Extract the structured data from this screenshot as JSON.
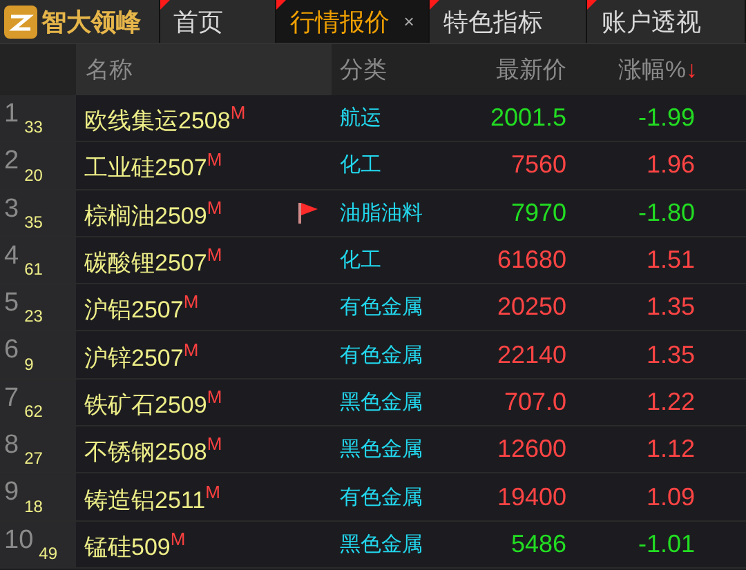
{
  "logo": {
    "text": "智大领峰"
  },
  "tabs": [
    {
      "label": "首页",
      "selected": false
    },
    {
      "label": "行情报价",
      "selected": true,
      "close": "×"
    },
    {
      "label": "特色指标",
      "selected": false
    },
    {
      "label": "账户透视",
      "selected": false
    }
  ],
  "table": {
    "columns": [
      {
        "label": "名称"
      },
      {
        "label": "分类"
      },
      {
        "label": "最新价"
      },
      {
        "label": "涨幅%",
        "sort_indicator": "↓"
      }
    ],
    "rows": [
      {
        "index": "1",
        "rank": "33",
        "name": "欧线集运2508$^{M}$",
        "flagged": false,
        "category": "航运",
        "price": "2001.5",
        "change": "-1.99",
        "color": "#22dd22"
      },
      {
        "index": "2",
        "rank": "20",
        "name": "工业硅2507$^{M}$",
        "flagged": false,
        "category": "化工",
        "price": "7560",
        "change": "1.96",
        "color": "#ff4444"
      },
      {
        "index": "3",
        "rank": "35",
        "name": "棕榈油2509$^{M}$",
        "flagged": true,
        "category": "油脂油料",
        "price": "7970",
        "change": "-1.80",
        "color": "#22dd22"
      },
      {
        "index": "4",
        "rank": "61",
        "name": "碳酸锂2507$^{M}$",
        "flagged": false,
        "category": "化工",
        "price": "61680",
        "change": "1.51",
        "color": "#ff4444"
      },
      {
        "index": "5",
        "rank": "23",
        "name": "沪铝2507$^{M}$",
        "flagged": false,
        "category": "有色金属",
        "price": "20250",
        "change": "1.35",
        "color": "#ff4444"
      },
      {
        "index": "6",
        "rank": "9",
        "name": "沪锌2507$^{M}$",
        "flagged": false,
        "category": "有色金属",
        "price": "22140",
        "change": "1.35",
        "color": "#ff4444"
      },
      {
        "index": "7",
        "rank": "62",
        "name": "铁矿石2509$^{M}$",
        "flagged": false,
        "category": "黑色金属",
        "price": "707.0",
        "change": "1.22",
        "color": "#ff4444"
      },
      {
        "index": "8",
        "rank": "27",
        "name": "不锈钢2508$^{M}$",
        "flagged": false,
        "category": "黑色金属",
        "price": "12600",
        "change": "1.12",
        "color": "#ff4444"
      },
      {
        "index": "9",
        "rank": "18",
        "name": "铸造铝2511$^{M}$",
        "flagged": false,
        "category": "有色金属",
        "price": "19400",
        "change": "1.09",
        "color": "#ff4444"
      },
      {
        "index": "10",
        "rank": "49",
        "name": "锰硅509$^{M}$",
        "flagged": false,
        "category": "黑色金属",
        "price": "5486",
        "change": "-1.01",
        "color": "#22dd22"
      }
    ]
  }
}
